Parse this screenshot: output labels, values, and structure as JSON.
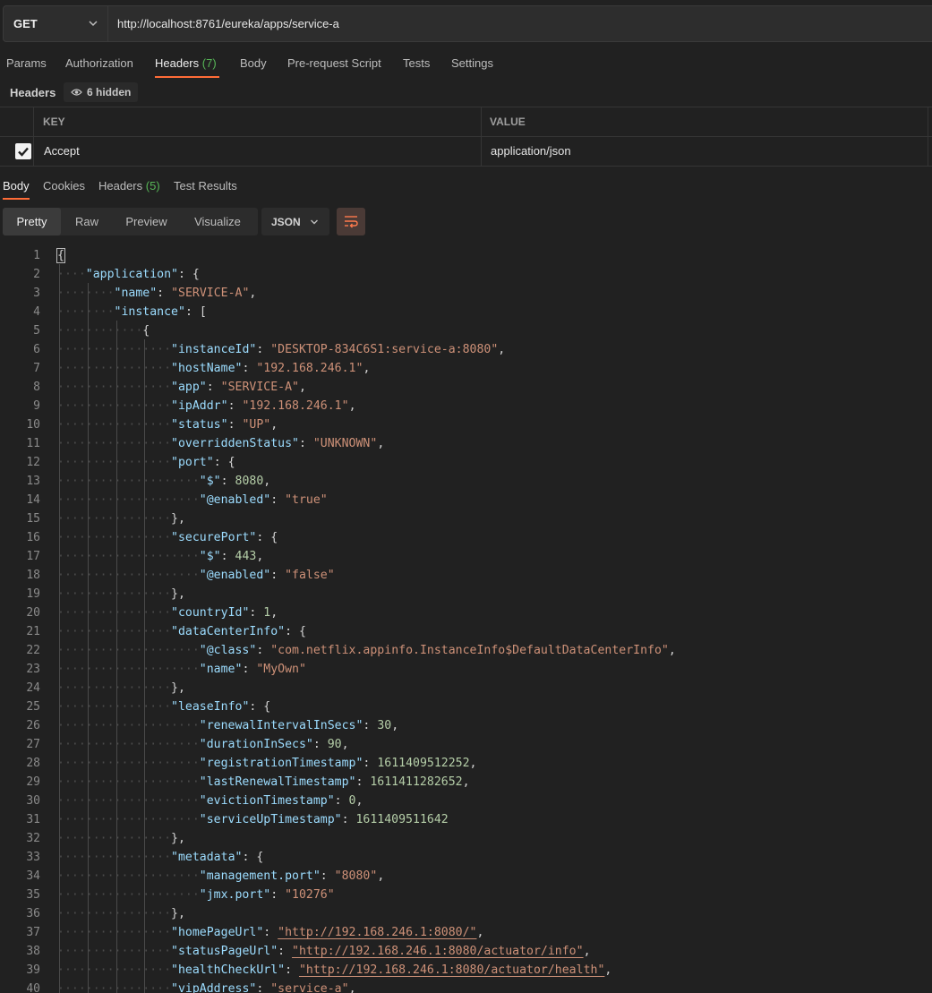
{
  "request": {
    "method": "GET",
    "url": "http://localhost:8761/eureka/apps/service-a"
  },
  "request_tabs": [
    {
      "label": "Params"
    },
    {
      "label": "Authorization"
    },
    {
      "label": "Headers",
      "count": "(7)"
    },
    {
      "label": "Body"
    },
    {
      "label": "Pre-request Script"
    },
    {
      "label": "Tests"
    },
    {
      "label": "Settings"
    }
  ],
  "headers_section": {
    "label": "Headers",
    "hidden_badge": "6 hidden"
  },
  "headers_table": {
    "columns": {
      "key": "KEY",
      "value": "VALUE"
    },
    "rows": [
      {
        "checked": true,
        "key": "Accept",
        "value": "application/json"
      }
    ]
  },
  "response_tabs": [
    {
      "label": "Body"
    },
    {
      "label": "Cookies"
    },
    {
      "label": "Headers",
      "count": "(5)"
    },
    {
      "label": "Test Results"
    }
  ],
  "view_modes": [
    "Pretty",
    "Raw",
    "Preview",
    "Visualize"
  ],
  "active_view_mode": "Pretty",
  "format": "JSON",
  "icons": {
    "method_dropdown": "chevron-down-icon",
    "eye": "eye-icon",
    "wrap": "wrap-lines-icon"
  },
  "colors": {
    "accent": "#ff6c37",
    "count": "#57b657",
    "key": "#9cdcfe",
    "string": "#ce9178",
    "number": "#b5cea8"
  },
  "code_lines": [
    {
      "n": "1",
      "indent": 0,
      "tokens": [
        {
          "c": "p",
          "t": "{"
        }
      ]
    },
    {
      "n": "2",
      "indent": 1,
      "tokens": [
        {
          "c": "k",
          "t": "\"application\""
        },
        {
          "c": "p",
          "t": ": {"
        }
      ]
    },
    {
      "n": "3",
      "indent": 2,
      "tokens": [
        {
          "c": "k",
          "t": "\"name\""
        },
        {
          "c": "p",
          "t": ": "
        },
        {
          "c": "s",
          "t": "\"SERVICE-A\""
        },
        {
          "c": "p",
          "t": ","
        }
      ]
    },
    {
      "n": "4",
      "indent": 2,
      "tokens": [
        {
          "c": "k",
          "t": "\"instance\""
        },
        {
          "c": "p",
          "t": ": ["
        }
      ]
    },
    {
      "n": "5",
      "indent": 3,
      "tokens": [
        {
          "c": "p",
          "t": "{"
        }
      ]
    },
    {
      "n": "6",
      "indent": 4,
      "tokens": [
        {
          "c": "k",
          "t": "\"instanceId\""
        },
        {
          "c": "p",
          "t": ": "
        },
        {
          "c": "s",
          "t": "\"DESKTOP-834C6S1:service-a:8080\""
        },
        {
          "c": "p",
          "t": ","
        }
      ]
    },
    {
      "n": "7",
      "indent": 4,
      "tokens": [
        {
          "c": "k",
          "t": "\"hostName\""
        },
        {
          "c": "p",
          "t": ": "
        },
        {
          "c": "s",
          "t": "\"192.168.246.1\""
        },
        {
          "c": "p",
          "t": ","
        }
      ]
    },
    {
      "n": "8",
      "indent": 4,
      "tokens": [
        {
          "c": "k",
          "t": "\"app\""
        },
        {
          "c": "p",
          "t": ": "
        },
        {
          "c": "s",
          "t": "\"SERVICE-A\""
        },
        {
          "c": "p",
          "t": ","
        }
      ]
    },
    {
      "n": "9",
      "indent": 4,
      "tokens": [
        {
          "c": "k",
          "t": "\"ipAddr\""
        },
        {
          "c": "p",
          "t": ": "
        },
        {
          "c": "s",
          "t": "\"192.168.246.1\""
        },
        {
          "c": "p",
          "t": ","
        }
      ]
    },
    {
      "n": "10",
      "indent": 4,
      "tokens": [
        {
          "c": "k",
          "t": "\"status\""
        },
        {
          "c": "p",
          "t": ": "
        },
        {
          "c": "s",
          "t": "\"UP\""
        },
        {
          "c": "p",
          "t": ","
        }
      ]
    },
    {
      "n": "11",
      "indent": 4,
      "tokens": [
        {
          "c": "k",
          "t": "\"overriddenStatus\""
        },
        {
          "c": "p",
          "t": ": "
        },
        {
          "c": "s",
          "t": "\"UNKNOWN\""
        },
        {
          "c": "p",
          "t": ","
        }
      ]
    },
    {
      "n": "12",
      "indent": 4,
      "tokens": [
        {
          "c": "k",
          "t": "\"port\""
        },
        {
          "c": "p",
          "t": ": {"
        }
      ]
    },
    {
      "n": "13",
      "indent": 5,
      "tokens": [
        {
          "c": "k",
          "t": "\"$\""
        },
        {
          "c": "p",
          "t": ": "
        },
        {
          "c": "n",
          "t": "8080"
        },
        {
          "c": "p",
          "t": ","
        }
      ]
    },
    {
      "n": "14",
      "indent": 5,
      "tokens": [
        {
          "c": "k",
          "t": "\"@enabled\""
        },
        {
          "c": "p",
          "t": ": "
        },
        {
          "c": "s",
          "t": "\"true\""
        }
      ]
    },
    {
      "n": "15",
      "indent": 4,
      "tokens": [
        {
          "c": "p",
          "t": "},"
        }
      ]
    },
    {
      "n": "16",
      "indent": 4,
      "tokens": [
        {
          "c": "k",
          "t": "\"securePort\""
        },
        {
          "c": "p",
          "t": ": {"
        }
      ]
    },
    {
      "n": "17",
      "indent": 5,
      "tokens": [
        {
          "c": "k",
          "t": "\"$\""
        },
        {
          "c": "p",
          "t": ": "
        },
        {
          "c": "n",
          "t": "443"
        },
        {
          "c": "p",
          "t": ","
        }
      ]
    },
    {
      "n": "18",
      "indent": 5,
      "tokens": [
        {
          "c": "k",
          "t": "\"@enabled\""
        },
        {
          "c": "p",
          "t": ": "
        },
        {
          "c": "s",
          "t": "\"false\""
        }
      ]
    },
    {
      "n": "19",
      "indent": 4,
      "tokens": [
        {
          "c": "p",
          "t": "},"
        }
      ]
    },
    {
      "n": "20",
      "indent": 4,
      "tokens": [
        {
          "c": "k",
          "t": "\"countryId\""
        },
        {
          "c": "p",
          "t": ": "
        },
        {
          "c": "n",
          "t": "1"
        },
        {
          "c": "p",
          "t": ","
        }
      ]
    },
    {
      "n": "21",
      "indent": 4,
      "tokens": [
        {
          "c": "k",
          "t": "\"dataCenterInfo\""
        },
        {
          "c": "p",
          "t": ": {"
        }
      ]
    },
    {
      "n": "22",
      "indent": 5,
      "tokens": [
        {
          "c": "k",
          "t": "\"@class\""
        },
        {
          "c": "p",
          "t": ": "
        },
        {
          "c": "s",
          "t": "\"com.netflix.appinfo.InstanceInfo$DefaultDataCenterInfo\""
        },
        {
          "c": "p",
          "t": ","
        }
      ]
    },
    {
      "n": "23",
      "indent": 5,
      "tokens": [
        {
          "c": "k",
          "t": "\"name\""
        },
        {
          "c": "p",
          "t": ": "
        },
        {
          "c": "s",
          "t": "\"MyOwn\""
        }
      ]
    },
    {
      "n": "24",
      "indent": 4,
      "tokens": [
        {
          "c": "p",
          "t": "},"
        }
      ]
    },
    {
      "n": "25",
      "indent": 4,
      "tokens": [
        {
          "c": "k",
          "t": "\"leaseInfo\""
        },
        {
          "c": "p",
          "t": ": {"
        }
      ]
    },
    {
      "n": "26",
      "indent": 5,
      "tokens": [
        {
          "c": "k",
          "t": "\"renewalIntervalInSecs\""
        },
        {
          "c": "p",
          "t": ": "
        },
        {
          "c": "n",
          "t": "30"
        },
        {
          "c": "p",
          "t": ","
        }
      ]
    },
    {
      "n": "27",
      "indent": 5,
      "tokens": [
        {
          "c": "k",
          "t": "\"durationInSecs\""
        },
        {
          "c": "p",
          "t": ": "
        },
        {
          "c": "n",
          "t": "90"
        },
        {
          "c": "p",
          "t": ","
        }
      ]
    },
    {
      "n": "28",
      "indent": 5,
      "tokens": [
        {
          "c": "k",
          "t": "\"registrationTimestamp\""
        },
        {
          "c": "p",
          "t": ": "
        },
        {
          "c": "n",
          "t": "1611409512252"
        },
        {
          "c": "p",
          "t": ","
        }
      ]
    },
    {
      "n": "29",
      "indent": 5,
      "tokens": [
        {
          "c": "k",
          "t": "\"lastRenewalTimestamp\""
        },
        {
          "c": "p",
          "t": ": "
        },
        {
          "c": "n",
          "t": "1611411282652"
        },
        {
          "c": "p",
          "t": ","
        }
      ]
    },
    {
      "n": "30",
      "indent": 5,
      "tokens": [
        {
          "c": "k",
          "t": "\"evictionTimestamp\""
        },
        {
          "c": "p",
          "t": ": "
        },
        {
          "c": "n",
          "t": "0"
        },
        {
          "c": "p",
          "t": ","
        }
      ]
    },
    {
      "n": "31",
      "indent": 5,
      "tokens": [
        {
          "c": "k",
          "t": "\"serviceUpTimestamp\""
        },
        {
          "c": "p",
          "t": ": "
        },
        {
          "c": "n",
          "t": "1611409511642"
        }
      ]
    },
    {
      "n": "32",
      "indent": 4,
      "tokens": [
        {
          "c": "p",
          "t": "},"
        }
      ]
    },
    {
      "n": "33",
      "indent": 4,
      "tokens": [
        {
          "c": "k",
          "t": "\"metadata\""
        },
        {
          "c": "p",
          "t": ": {"
        }
      ]
    },
    {
      "n": "34",
      "indent": 5,
      "tokens": [
        {
          "c": "k",
          "t": "\"management.port\""
        },
        {
          "c": "p",
          "t": ": "
        },
        {
          "c": "s",
          "t": "\"8080\""
        },
        {
          "c": "p",
          "t": ","
        }
      ]
    },
    {
      "n": "35",
      "indent": 5,
      "tokens": [
        {
          "c": "k",
          "t": "\"jmx.port\""
        },
        {
          "c": "p",
          "t": ": "
        },
        {
          "c": "s",
          "t": "\"10276\""
        }
      ]
    },
    {
      "n": "36",
      "indent": 4,
      "tokens": [
        {
          "c": "p",
          "t": "},"
        }
      ]
    },
    {
      "n": "37",
      "indent": 4,
      "tokens": [
        {
          "c": "k",
          "t": "\"homePageUrl\""
        },
        {
          "c": "p",
          "t": ": "
        },
        {
          "c": "u",
          "t": "\"http://192.168.246.1:8080/\""
        },
        {
          "c": "p",
          "t": ","
        }
      ]
    },
    {
      "n": "38",
      "indent": 4,
      "tokens": [
        {
          "c": "k",
          "t": "\"statusPageUrl\""
        },
        {
          "c": "p",
          "t": ": "
        },
        {
          "c": "u",
          "t": "\"http://192.168.246.1:8080/actuator/info\""
        },
        {
          "c": "p",
          "t": ","
        }
      ]
    },
    {
      "n": "39",
      "indent": 4,
      "tokens": [
        {
          "c": "k",
          "t": "\"healthCheckUrl\""
        },
        {
          "c": "p",
          "t": ": "
        },
        {
          "c": "u",
          "t": "\"http://192.168.246.1:8080/actuator/health\""
        },
        {
          "c": "p",
          "t": ","
        }
      ]
    },
    {
      "n": "40",
      "indent": 4,
      "tokens": [
        {
          "c": "k",
          "t": "\"vipAddress\""
        },
        {
          "c": "p",
          "t": ": "
        },
        {
          "c": "s",
          "t": "\"service-a\""
        },
        {
          "c": "p",
          "t": ","
        }
      ]
    }
  ]
}
